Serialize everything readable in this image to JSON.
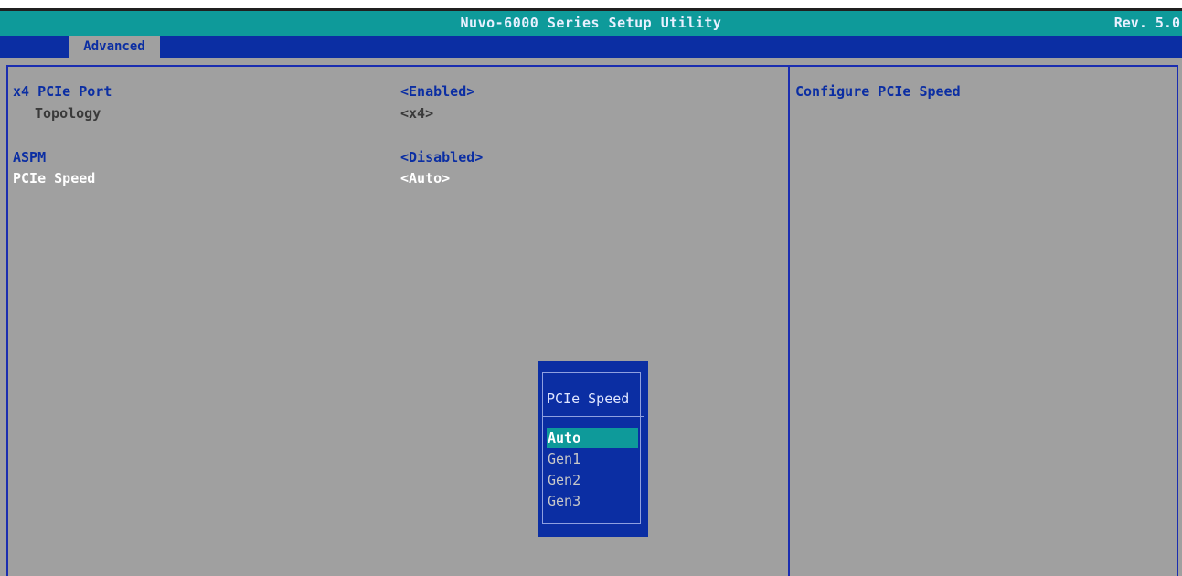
{
  "header": {
    "title": "Nuvo-6000 Series Setup Utility",
    "revision": "Rev. 5.0"
  },
  "tabs": [
    {
      "label": "Advanced",
      "active": true
    }
  ],
  "settings": [
    {
      "label": "x4 PCIe Port",
      "value": "<Enabled>"
    },
    {
      "label": "Topology",
      "value": "<x4>"
    },
    {
      "label": "ASPM",
      "value": "<Disabled>"
    },
    {
      "label": "PCIe Speed",
      "value": "<Auto>"
    }
  ],
  "help": {
    "text": "Configure PCIe Speed"
  },
  "popup": {
    "title": "PCIe Speed",
    "options": [
      "Auto",
      "Gen1",
      "Gen2",
      "Gen3"
    ],
    "selected": "Auto"
  },
  "colors": {
    "background": "#a0a0a0",
    "title_bar": "#0e9a9a",
    "tab_bar": "#0b2ea3",
    "text_blue": "#0b2ea3",
    "highlight": "#0e9a9a"
  }
}
